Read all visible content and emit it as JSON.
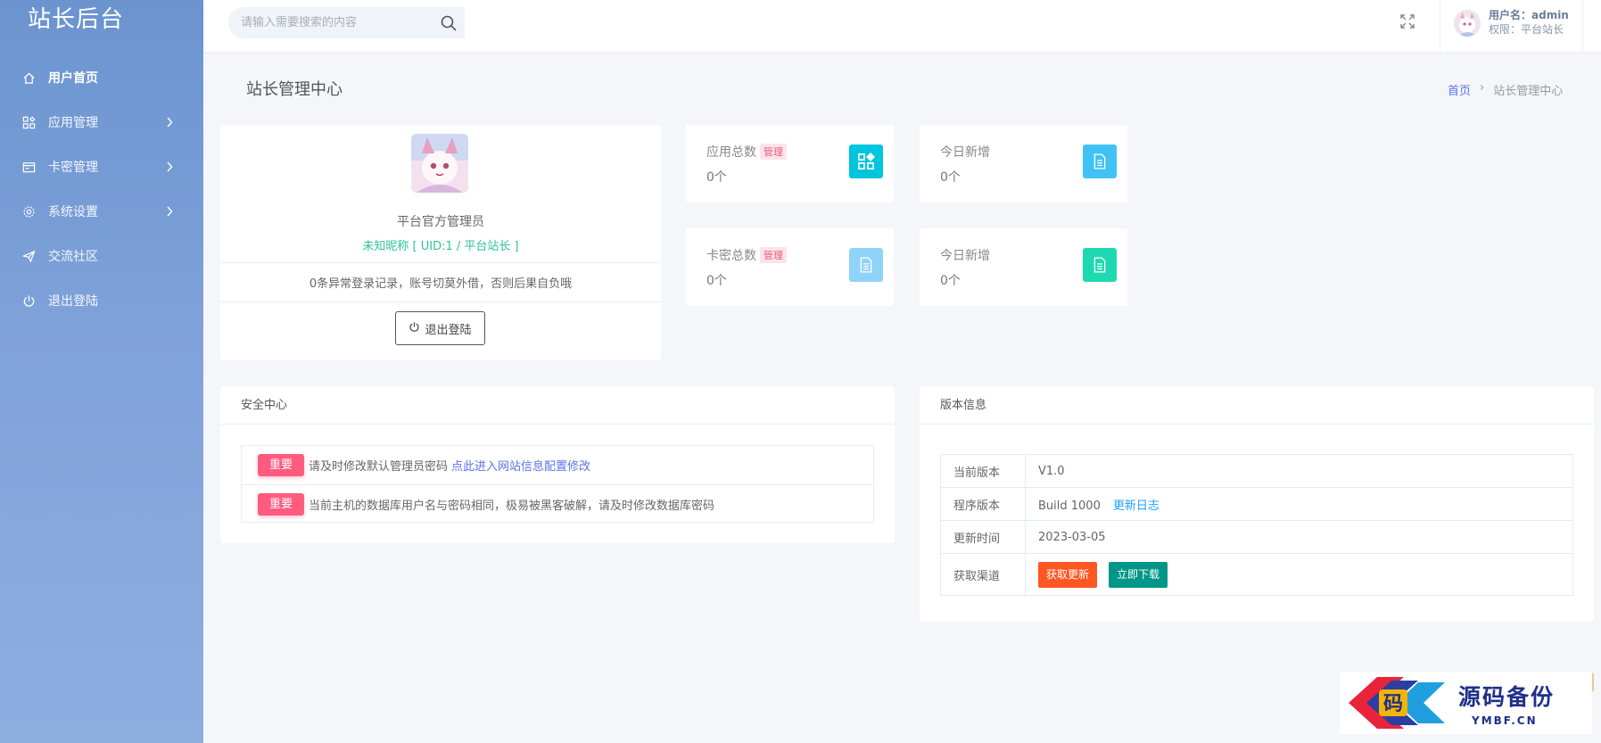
{
  "brand": "站长后台",
  "sidebar": {
    "items": [
      {
        "label": "用户首页",
        "active": true,
        "chevron": false
      },
      {
        "label": "应用管理",
        "active": false,
        "chevron": true
      },
      {
        "label": "卡密管理",
        "active": false,
        "chevron": true
      },
      {
        "label": "系统设置",
        "active": false,
        "chevron": true
      },
      {
        "label": "交流社区",
        "active": false,
        "chevron": false
      },
      {
        "label": "退出登陆",
        "active": false,
        "chevron": false
      }
    ]
  },
  "topbar": {
    "search_placeholder": "请输入需要搜索的内容",
    "username_label": "用户名：admin",
    "role_label": "权限：平台站长"
  },
  "page": {
    "title": "站长管理中心",
    "breadcrumb_home": "首页",
    "breadcrumb_sep": "›",
    "breadcrumb_current": "站长管理中心"
  },
  "profile": {
    "name": "平台官方管理员",
    "subtitle": "未知昵称 [ UID:1 / 平台站长 ]",
    "notice": "0条异常登录记录，账号切莫外借，否则后果自负哦",
    "logout_label": "退出登陆"
  },
  "stats": [
    {
      "label": "应用总数",
      "badge": "管理",
      "value": "0个",
      "color": "#00c5dc"
    },
    {
      "label": "今日新增",
      "badge": "",
      "value": "0个",
      "color": "#40c2f5"
    },
    {
      "label": "卡密总数",
      "badge": "管理",
      "value": "0个",
      "color": "#8fd3f8"
    },
    {
      "label": "今日新增",
      "badge": "",
      "value": "0个",
      "color": "#1ed9b0"
    }
  ],
  "security": {
    "title": "安全中心",
    "tag": "重要",
    "rows": [
      {
        "text": "请及时修改默认管理员密码",
        "link": "点此进入网站信息配置修改"
      },
      {
        "text": "当前主机的数据库用户名与密码相同，极易被黑客破解，请及时修改数据库密码",
        "link": ""
      }
    ]
  },
  "version": {
    "title": "版本信息",
    "current_label": "当前版本",
    "current_value": "V1.0",
    "program_label": "程序版本",
    "program_value": "Build 1000",
    "changelog": "更新日志",
    "updated_label": "更新时间",
    "updated_value": "2023-03-05",
    "channel_label": "获取渠道",
    "btn_update": "获取更新",
    "btn_download": "立即下载"
  },
  "watermark": {
    "text": "源码备份",
    "sub": "YMBF.CN",
    "logo_char": "码"
  }
}
